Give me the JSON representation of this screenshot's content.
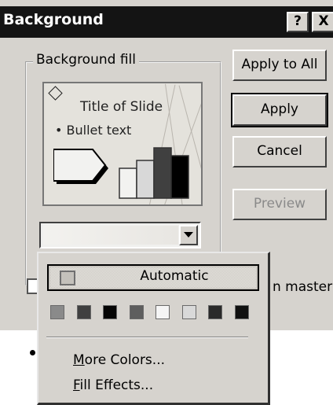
{
  "window": {
    "title": "Background",
    "help_label": "?",
    "close_label": "X"
  },
  "fill_group": {
    "legend": "Background fill"
  },
  "preview": {
    "title_text": "Title of Slide",
    "bullet_text": "• Bullet text"
  },
  "buttons": {
    "apply_to_all": "Apply to All",
    "apply": "Apply",
    "cancel": "Cancel",
    "preview": "Preview"
  },
  "omit_checkbox": {
    "label_visible": "n master",
    "checked": false
  },
  "color_menu": {
    "automatic_label": "Automatic",
    "swatches": [
      "#8a8a8a",
      "#404040",
      "#050505",
      "#5e5e5e",
      "#f5f5f5",
      "#d9d9d9",
      "#2a2a2a",
      "#101010"
    ],
    "more_colors": {
      "underlined": "M",
      "rest": "ore Colors..."
    },
    "fill_effects": {
      "underlined": "F",
      "rest": "ill Effects..."
    }
  },
  "colors": {
    "title_bar": "#141414",
    "dialog_face": "#d6d3ce",
    "preview_bg": "#e4e2dc"
  }
}
